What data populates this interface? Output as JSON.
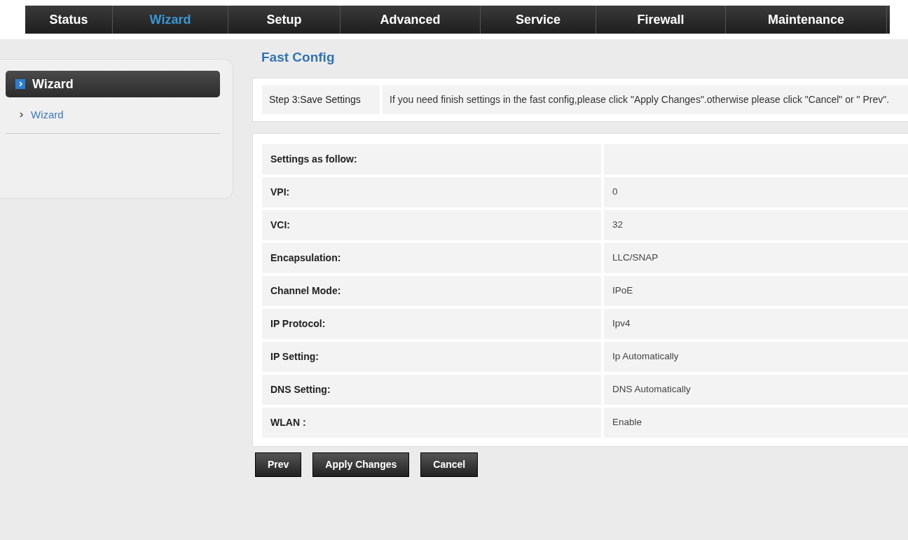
{
  "top_menu": [
    {
      "label": "Status",
      "selected": false
    },
    {
      "label": "Wizard",
      "selected": true
    },
    {
      "label": "Setup",
      "selected": false
    },
    {
      "label": "Advanced",
      "selected": false
    },
    {
      "label": "Service",
      "selected": false
    },
    {
      "label": "Firewall",
      "selected": false
    },
    {
      "label": "Maintenance",
      "selected": false
    }
  ],
  "sidebar": {
    "heading": "Wizard",
    "items": [
      {
        "label": "Wizard"
      }
    ]
  },
  "page_title": "Fast Config",
  "step": {
    "label": "Step 3:Save Settings",
    "message": "If you need finish settings in the fast config,please click \"Apply Changes\".otherwise please click \"Cancel\" or \" Prev\"."
  },
  "settings": {
    "heading": "Settings as follow:",
    "rows": [
      {
        "label": "VPI:",
        "value": "0"
      },
      {
        "label": "VCI:",
        "value": "32"
      },
      {
        "label": "Encapsulation:",
        "value": "LLC/SNAP"
      },
      {
        "label": "Channel Mode:",
        "value": "IPoE"
      },
      {
        "label": "IP Protocol:",
        "value": "Ipv4"
      },
      {
        "label": "IP Setting:",
        "value": "Ip Automatically"
      },
      {
        "label": "DNS Setting:",
        "value": "DNS Automatically"
      },
      {
        "label": "WLAN :",
        "value": "Enable"
      }
    ]
  },
  "buttons": [
    "Prev",
    "Apply Changes",
    "Cancel"
  ]
}
